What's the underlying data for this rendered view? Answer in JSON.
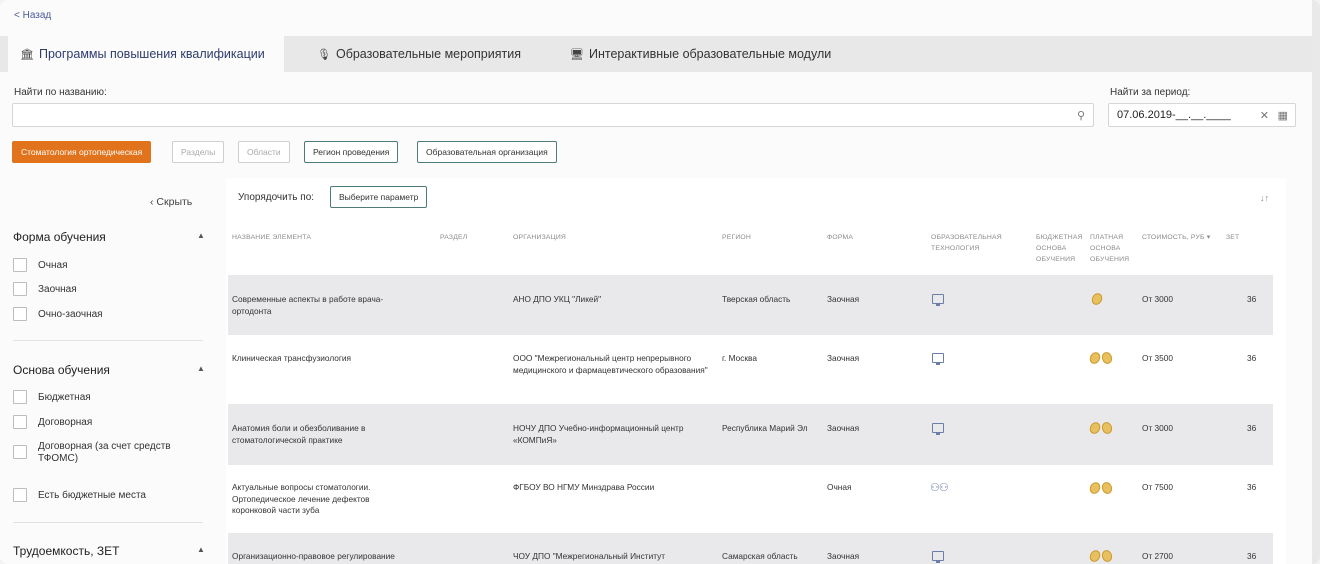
{
  "nav": {
    "back_label": "< Назад"
  },
  "tabs": [
    {
      "label": "Программы повышения квалификации",
      "icon": "building-icon"
    },
    {
      "label": "Образовательные мероприятия",
      "icon": "microphone-icon"
    },
    {
      "label": "Интерактивные образовательные модули",
      "icon": "monitor-icon"
    }
  ],
  "search": {
    "name_label": "Найти по названию:",
    "name_value": "",
    "period_label": "Найти за период:",
    "period_value": "07.06.2019-__.__.____"
  },
  "filter_chips": [
    "Стоматология ортопедическая",
    "Разделы",
    "Области",
    "Регион проведения",
    "Образовательная организация"
  ],
  "sidebar": {
    "hide_label": "Скрыть",
    "groups": [
      {
        "title": "Форма обучения",
        "options": [
          "Очная",
          "Заочная",
          "Очно-заочная"
        ]
      },
      {
        "title": "Основа обучения",
        "options": [
          "Бюджетная",
          "Договорная",
          "Договорная (за счет средств ТФОМС)",
          "Есть бюджетные места"
        ]
      },
      {
        "title": "Трудоемкость, ЗЕТ",
        "options": []
      }
    ]
  },
  "sort": {
    "label": "Упорядочить по:",
    "button": "Выберите параметр"
  },
  "table": {
    "headers": [
      "Название элемента",
      "Раздел",
      "Организация",
      "Регион",
      "Форма",
      "Образовательная технология",
      "Бюджетная основа обучения",
      "Платная основа обучения",
      "Стоимость, руб ▾",
      "ЗЕТ"
    ],
    "rows": [
      {
        "name": "Современные аспекты в работе врача-ортодонта",
        "section": "",
        "org": "АНО ДПО УКЦ \"Ликей\"",
        "region": "Тверская область",
        "form": "Заочная",
        "tech": "monitor-icon",
        "paid": "coin-icon",
        "cost": "От 3000",
        "zet": "36"
      },
      {
        "name": "Клиническая трансфузиология",
        "section": "",
        "org": "ООО \"Межрегиональный центр непрерывного медицинского и фармацевтического образования\"",
        "region": "г. Москва",
        "form": "Заочная",
        "tech": "monitor-icon",
        "paid": "coins-icon",
        "cost": "От 3500",
        "zet": "36"
      },
      {
        "name": "Анатомия боли и обезболивание в стоматологической практике",
        "section": "",
        "org": "НОЧУ ДПО Учебно-информационный центр «КОМПиЯ»",
        "region": "Республика Марий Эл",
        "form": "Заочная",
        "tech": "monitor-icon",
        "paid": "coins-icon",
        "cost": "От 3000",
        "zet": "36"
      },
      {
        "name": "Актуальные вопросы стоматологии. Ортопедическое лечение дефектов коронковой части зуба",
        "section": "",
        "org": "ФГБОУ ВО НГМУ Минздрава России",
        "region": "",
        "form": "Очная",
        "tech": "group-icon",
        "paid": "coins-icon",
        "cost": "От 7500",
        "zet": "36"
      },
      {
        "name": "Организационно-правовое регулирование",
        "section": "",
        "org": "ЧОУ ДПО \"Межрегиональный Институт",
        "region": "Самарская область",
        "form": "Заочная",
        "tech": "monitor-icon",
        "paid": "coins-icon",
        "cost": "От 2700",
        "zet": "36"
      }
    ]
  }
}
